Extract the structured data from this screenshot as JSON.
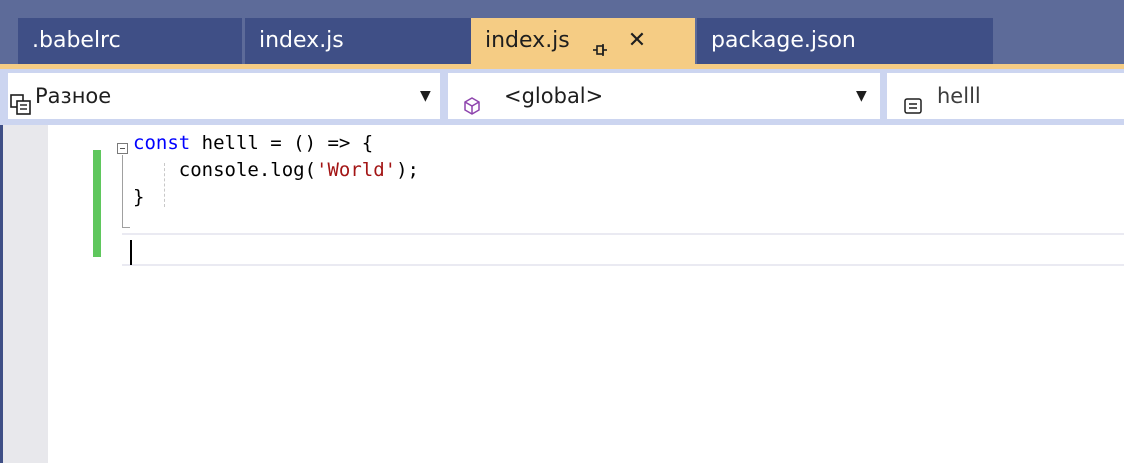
{
  "tabs": [
    {
      "label": ".babelrc",
      "active": false
    },
    {
      "label": "index.js",
      "active": false
    },
    {
      "label": "index.js",
      "active": true,
      "pinned": false
    },
    {
      "label": "package.json",
      "active": false
    }
  ],
  "colors": {
    "tab_strip": "#5d6b99",
    "tab_inactive": "#3f4f86",
    "tab_active": "#f5cc84",
    "navbar": "#ccd5f0",
    "change_bar": "#5fc75d",
    "keyword": "#0000ff",
    "string": "#a31515"
  },
  "navbar": {
    "project": {
      "label": "Разное",
      "icon": "project-file-icon"
    },
    "scope": {
      "label": "<global>",
      "icon": "cube-icon"
    },
    "member": {
      "label": "helll",
      "icon": "member-icon"
    }
  },
  "code": {
    "line1_keyword": "const",
    "line1_rest": " helll = () => {",
    "line2_prefix": "    console.log(",
    "line2_string": "'World'",
    "line2_suffix": ");",
    "line3": "}"
  }
}
